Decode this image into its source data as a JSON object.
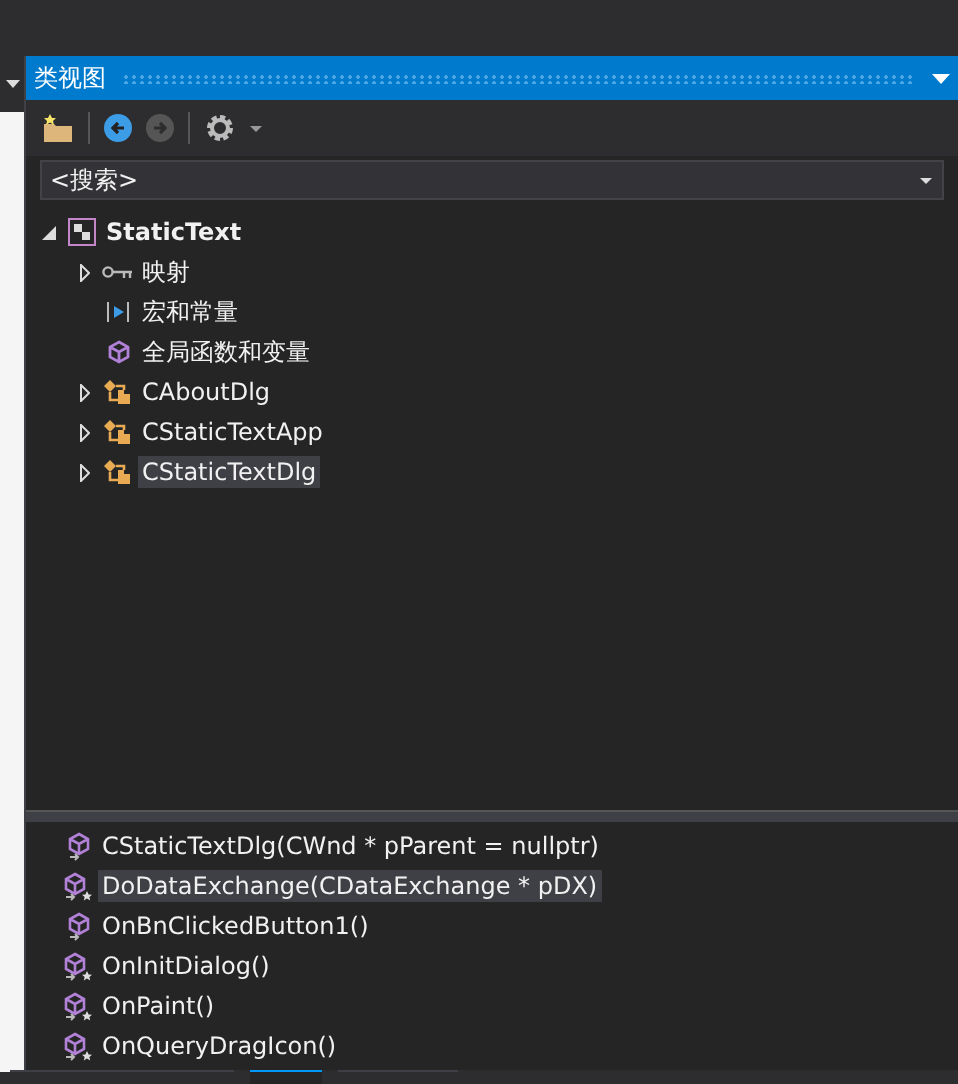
{
  "panel": {
    "title": "类视图"
  },
  "search": {
    "placeholder": "<搜索>"
  },
  "tree": [
    {
      "label": "StaticText",
      "kind": "project",
      "expanded": true,
      "selected": false,
      "children": [
        {
          "label": "映射",
          "kind": "map",
          "expandable": true,
          "expanded": false,
          "selected": false
        },
        {
          "label": "宏和常量",
          "kind": "macro",
          "expandable": false,
          "selected": false
        },
        {
          "label": "全局函数和变量",
          "kind": "global",
          "expandable": false,
          "selected": false
        },
        {
          "label": "CAboutDlg",
          "kind": "class",
          "expandable": true,
          "expanded": false,
          "selected": false
        },
        {
          "label": "CStaticTextApp",
          "kind": "class",
          "expandable": true,
          "expanded": false,
          "selected": false
        },
        {
          "label": "CStaticTextDlg",
          "kind": "class",
          "expandable": true,
          "expanded": false,
          "selected": true
        }
      ]
    }
  ],
  "members": [
    {
      "label": "CStaticTextDlg(CWnd * pParent = nullptr)",
      "kind": "method",
      "selected": false
    },
    {
      "label": "DoDataExchange(CDataExchange * pDX)",
      "kind": "override",
      "selected": true
    },
    {
      "label": "OnBnClickedButton1()",
      "kind": "method",
      "selected": false
    },
    {
      "label": "OnInitDialog()",
      "kind": "override",
      "selected": false
    },
    {
      "label": "OnPaint()",
      "kind": "override",
      "selected": false
    },
    {
      "label": "OnQueryDragIcon()",
      "kind": "override",
      "selected": false
    }
  ],
  "bottom_tabs": [
    {
      "selected": false
    },
    {
      "selected": true
    },
    {
      "selected": false
    }
  ]
}
